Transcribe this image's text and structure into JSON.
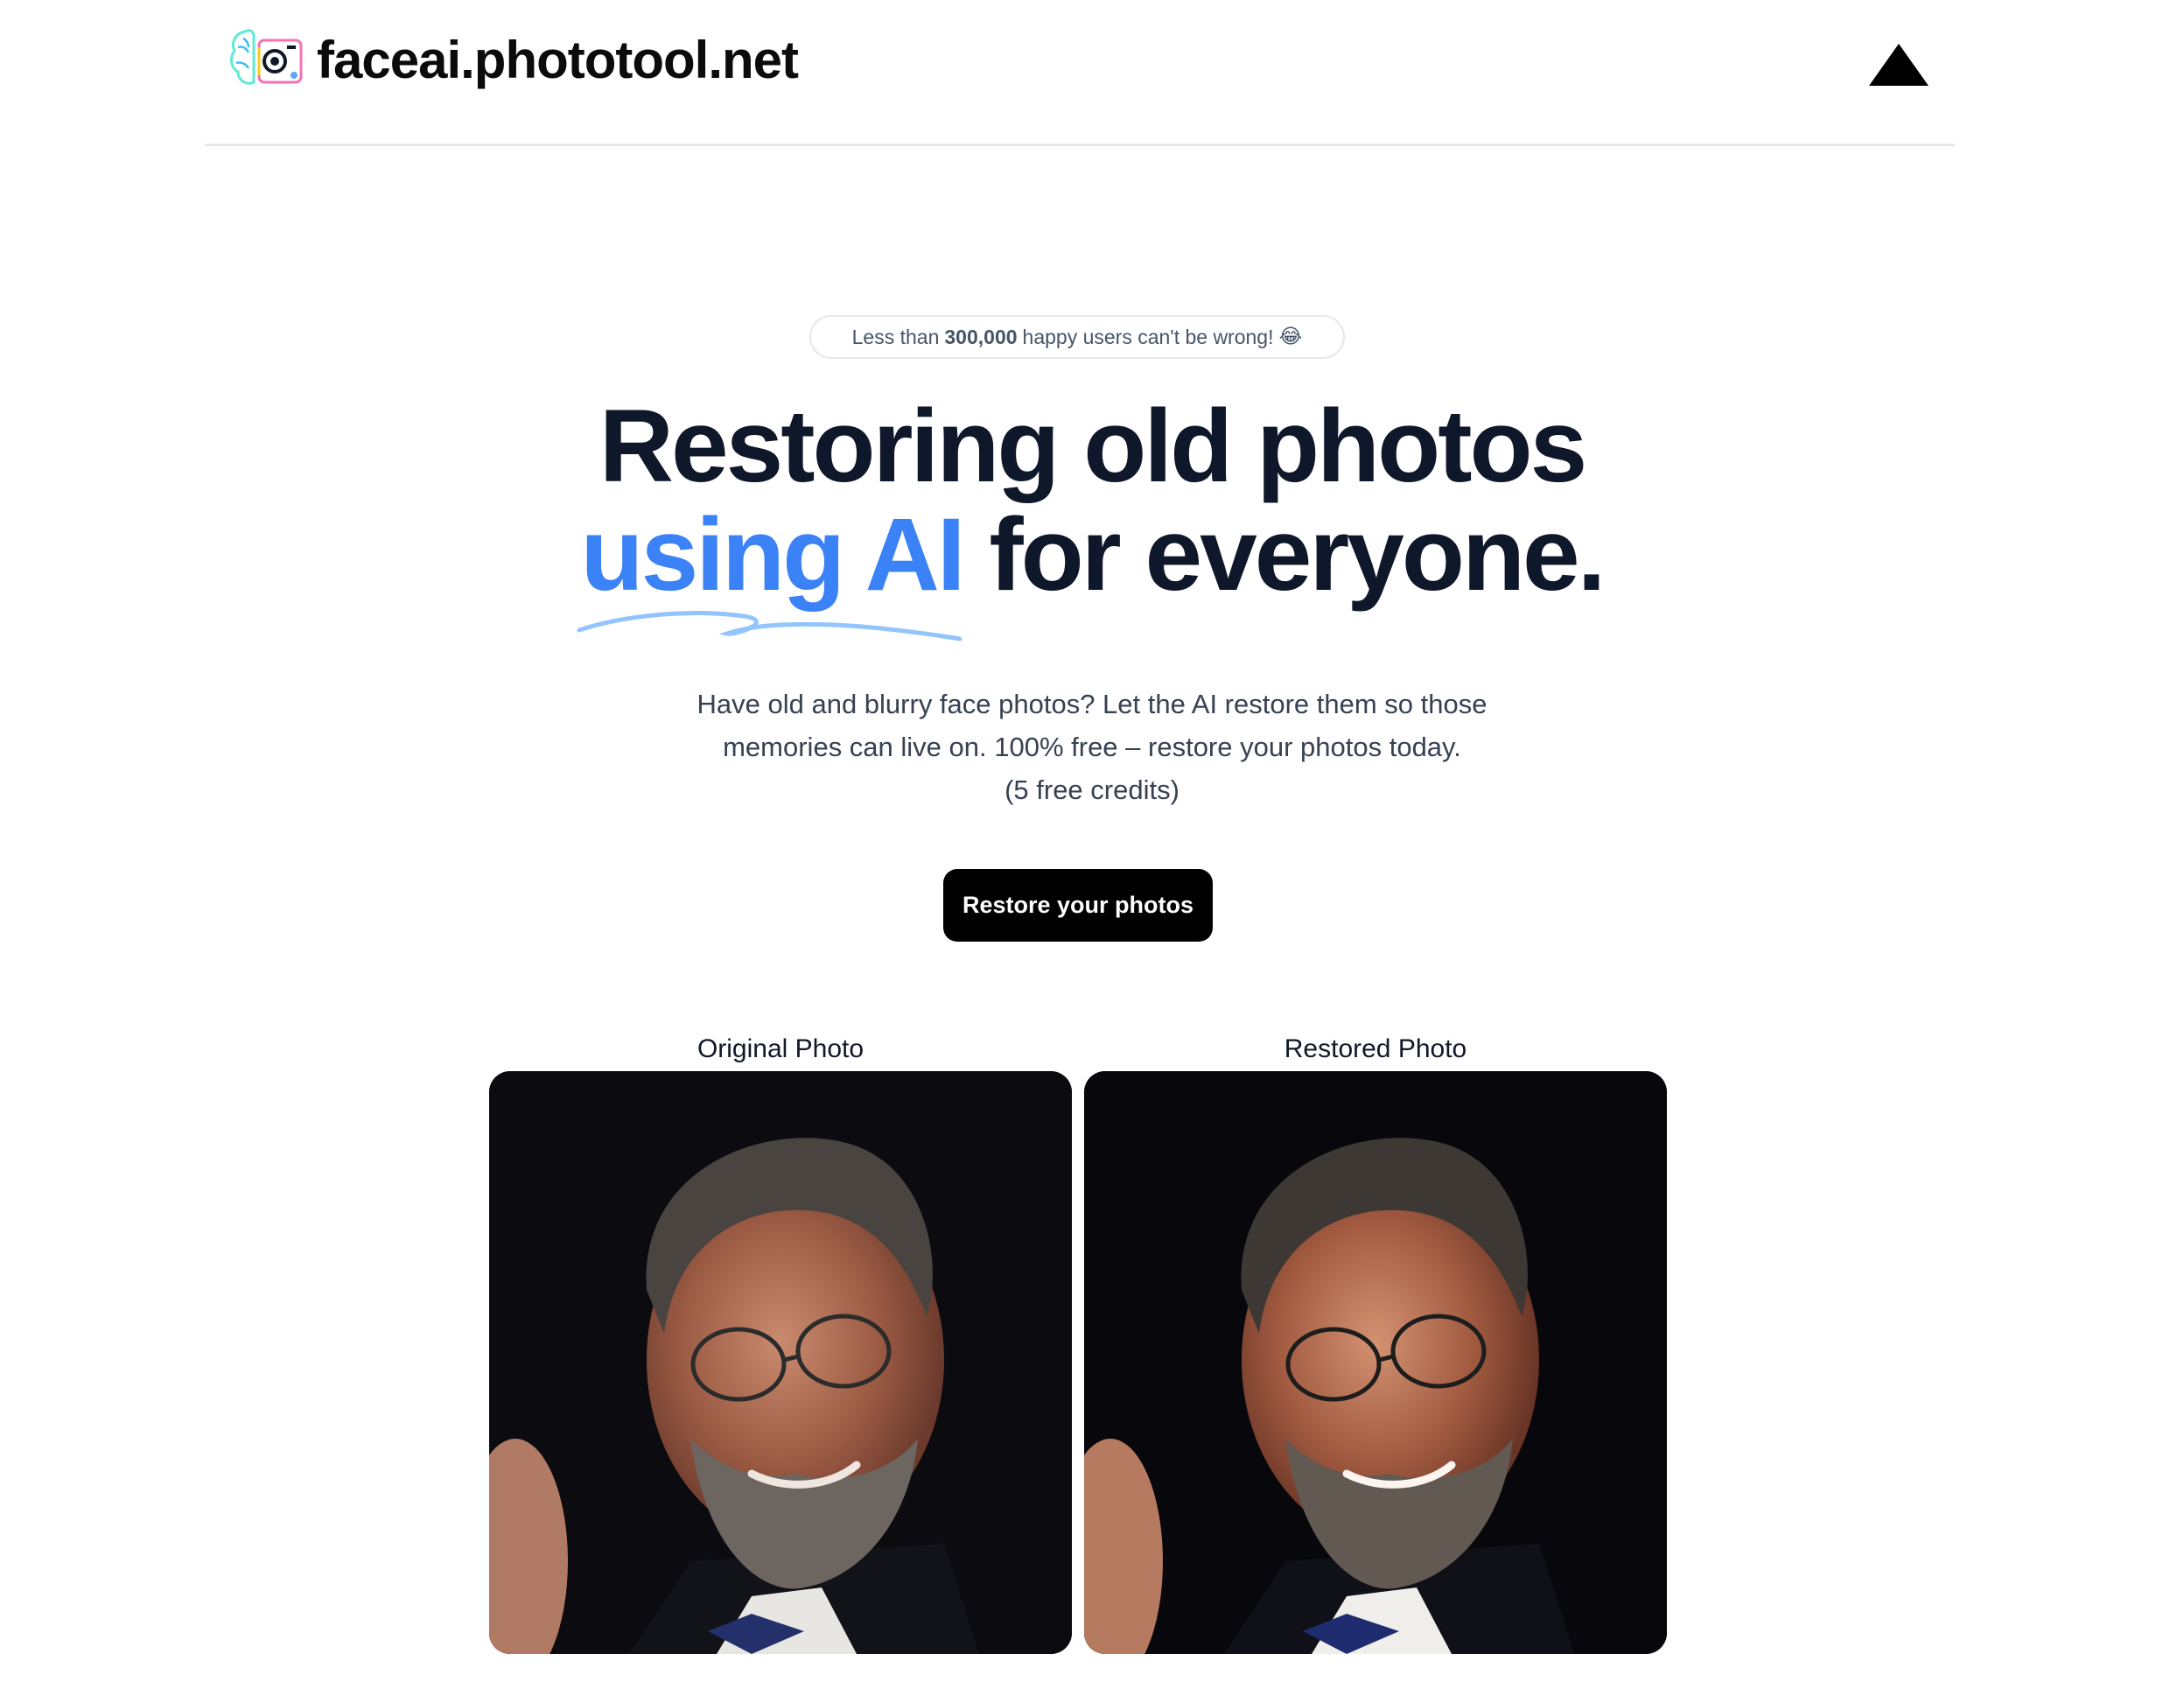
{
  "header": {
    "site_name": "faceai.phototool.net",
    "logo_icon": "brain-camera-logo-icon",
    "right_icon": "triangle-logo-icon"
  },
  "badge": {
    "prefix": "Less than",
    "count": "300,000",
    "suffix": "happy users can't be wrong!",
    "emoji": "😂"
  },
  "hero": {
    "title_line1": "Restoring old photos",
    "title_accent": "using AI",
    "title_rest": " for everyone.",
    "accent_color": "#3b82f6",
    "description_line1": "Have old and blurry face photos? Let the AI restore them so those",
    "description_line2": "memories can live on. 100% free – restore your photos today.",
    "description_line3": "(5 free credits)",
    "cta_label": "Restore your photos"
  },
  "photos": {
    "original_label": "Original Photo",
    "restored_label": "Restored Photo"
  }
}
